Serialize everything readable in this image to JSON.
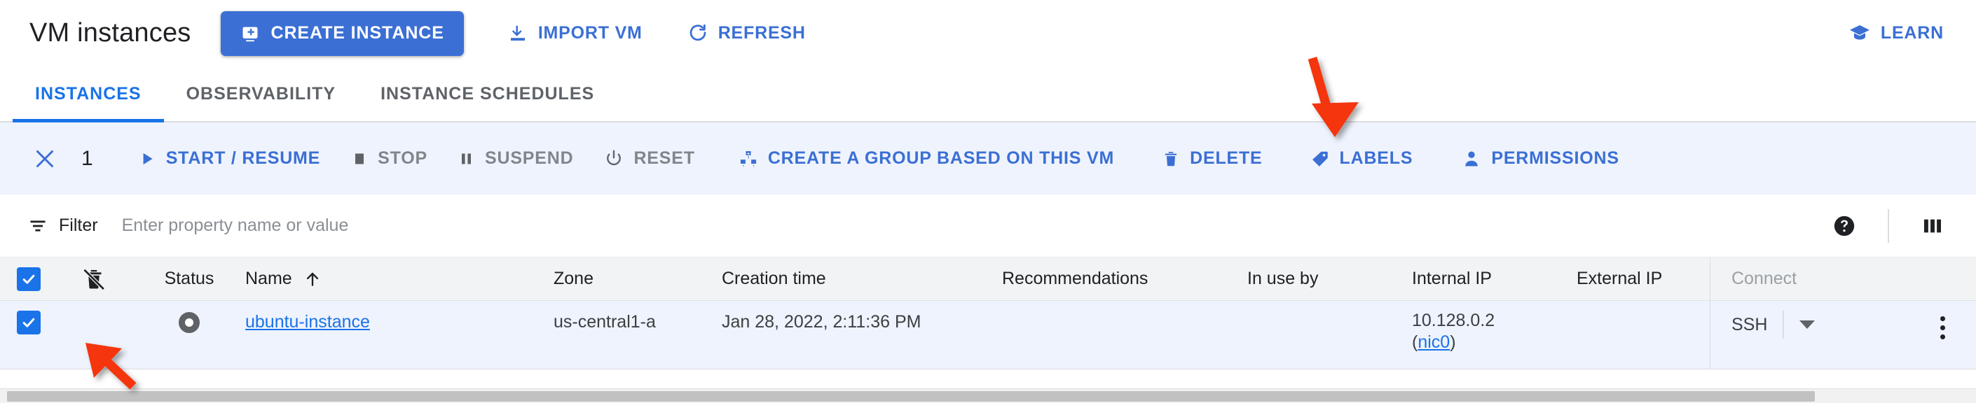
{
  "header": {
    "title": "VM instances",
    "create_label": "CREATE INSTANCE",
    "import_label": "IMPORT VM",
    "refresh_label": "REFRESH",
    "learn_label": "LEARN",
    "icons": {
      "create": "add-instance-icon",
      "import": "download-icon",
      "refresh": "refresh-icon",
      "learn": "graduation-cap-icon"
    }
  },
  "tabs": [
    {
      "label": "INSTANCES",
      "active": true
    },
    {
      "label": "OBSERVABILITY",
      "active": false
    },
    {
      "label": "INSTANCE SCHEDULES",
      "active": false
    }
  ],
  "toolbar": {
    "selected_count": "1",
    "close_icon": "close-icon",
    "actions": [
      {
        "label": "START / RESUME",
        "icon": "play-icon",
        "disabled": false
      },
      {
        "label": "STOP",
        "icon": "stop-square-icon",
        "disabled": true
      },
      {
        "label": "SUSPEND",
        "icon": "pause-icon",
        "disabled": true
      },
      {
        "label": "RESET",
        "icon": "power-reset-icon",
        "disabled": true
      },
      {
        "label": "CREATE A GROUP BASED ON THIS VM",
        "icon": "instance-group-icon",
        "disabled": false
      },
      {
        "label": "DELETE",
        "icon": "trash-icon",
        "disabled": false
      },
      {
        "label": "LABELS",
        "icon": "label-tag-icon",
        "disabled": false
      },
      {
        "label": "PERMISSIONS",
        "icon": "person-icon",
        "disabled": false
      }
    ]
  },
  "filter": {
    "label": "Filter",
    "placeholder": "Enter property name or value",
    "value": "",
    "filter_icon": "filter-list-icon",
    "help_icon": "help-circle-icon",
    "columns_icon": "column-display-options-icon"
  },
  "table": {
    "columns": [
      {
        "key": "check",
        "label": ""
      },
      {
        "key": "protect",
        "label": ""
      },
      {
        "key": "status",
        "label": "Status"
      },
      {
        "key": "name",
        "label": "Name"
      },
      {
        "key": "zone",
        "label": "Zone"
      },
      {
        "key": "created",
        "label": "Creation time"
      },
      {
        "key": "recs",
        "label": "Recommendations"
      },
      {
        "key": "inuse",
        "label": "In use by"
      },
      {
        "key": "intip",
        "label": "Internal IP"
      },
      {
        "key": "extip",
        "label": "External IP"
      },
      {
        "key": "connect",
        "label": "Connect"
      }
    ],
    "sort": {
      "column": "Name",
      "direction": "asc",
      "icon": "sort-arrow-up-icon"
    },
    "header_icons": {
      "select_all": "checkbox-checked-icon",
      "deletion_protection": "delete-protection-icon"
    },
    "rows": [
      {
        "selected": true,
        "status_icon": "status-stopped-icon",
        "name": "ubuntu-instance",
        "zone": "us-central1-a",
        "created": "Jan 28, 2022, 2:11:36 PM",
        "recommendations": "",
        "in_use_by": "",
        "internal_ip": "10.128.0.2",
        "internal_ip_nic_prefix": "(",
        "internal_ip_nic": "nic0",
        "internal_ip_nic_suffix": ")",
        "external_ip": "",
        "connect_label": "SSH",
        "connect_caret_icon": "chevron-down-icon",
        "row_menu_icon": "more-vert-icon"
      }
    ]
  },
  "annotations": [
    {
      "name": "arrow-to-delete-button",
      "color": "#F4350B"
    },
    {
      "name": "arrow-to-row-checkbox",
      "color": "#F4350B"
    }
  ],
  "scrollbar": {
    "name": "horizontal-scrollbar"
  },
  "colors": {
    "brand_blue": "#1a73e8",
    "button_blue": "#3b6fd4",
    "selected_row": "#eef3fd",
    "header_grey": "#f1f3f4",
    "annotation_red": "#F4350B"
  }
}
